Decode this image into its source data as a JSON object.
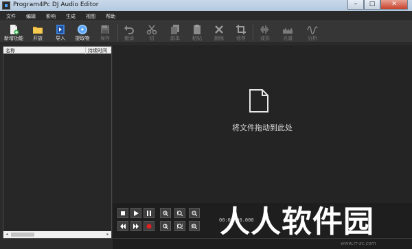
{
  "window": {
    "title": "Program4Pc DJ Audio Editor",
    "minimize_glyph": "–",
    "maximize_glyph": "□",
    "close_glyph": "✕"
  },
  "menu": [
    "文件",
    "编辑",
    "影响",
    "生成",
    "视图",
    "帮助"
  ],
  "toolbar": {
    "new_project": "新增功能",
    "open": "开放",
    "import": "导入",
    "extract": "提取物",
    "save": "保存",
    "undo": "撤消",
    "cut": "切",
    "copy": "副本",
    "paste": "粘贴",
    "delete": "删除",
    "trim": "修剪",
    "waveform": "波形",
    "spectrum": "光谱",
    "analyze": "分析"
  },
  "file_list": {
    "col_name": "名称",
    "col_duration": "持续时间",
    "scroll_left": "◂",
    "scroll_right": "▸"
  },
  "drop_zone": {
    "text": "将文件拖动到此处"
  },
  "transport": {
    "time": "00:00:00.000"
  },
  "watermark": {
    "text": "人人软件园",
    "sub": "www.rr-sc.com"
  },
  "colors": {
    "record": "#e02020",
    "titlebar": "#c9d9ea",
    "background": "#2b2b2b"
  }
}
